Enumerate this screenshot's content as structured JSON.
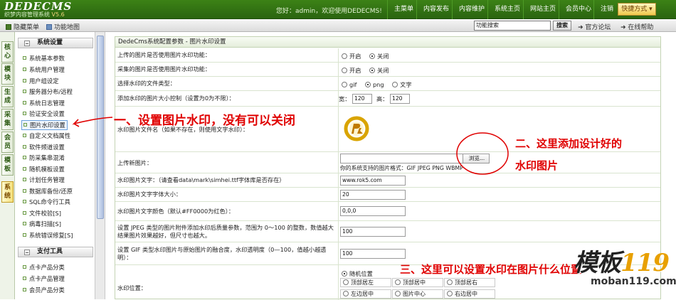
{
  "header": {
    "logo": "DEDECMS",
    "logo_sub": "织梦内容管理系统",
    "version": "V5.6",
    "welcome": "您好：admin，欢迎使用DEDECMS!",
    "nav": [
      "主菜单",
      "内容发布",
      "内容维护",
      "系统主页",
      "网站主页",
      "会员中心",
      "注销"
    ],
    "quick": "快捷方式"
  },
  "toolbar": {
    "hide_menu": "隐藏菜单",
    "func_map": "功能地图",
    "search_value": "功能搜索",
    "search_btn": "搜索",
    "forum": "官方论坛",
    "help": "在线帮助"
  },
  "vtabs": [
    "核心",
    "模块",
    "生成",
    "采集",
    "会员",
    "模板",
    "系统"
  ],
  "sidebar": {
    "section1": "系统设置",
    "items1": [
      "系统基本参数",
      "系统用户管理",
      "用户组设定",
      "服务器分布/远程",
      "系统日志管理",
      "验证安全设置",
      "图片水印设置",
      "自定义文档属性",
      "软件频道设置",
      "防采集串混淆",
      "随机模板设置",
      "计划任务管理",
      "数据库备份/还原",
      "SQL命令行工具",
      "文件校验[S]",
      "病毒扫描[S]",
      "系统错误修复[S]"
    ],
    "section2": "支付工具",
    "items2": [
      "点卡产品分类",
      "点卡产品管理",
      "会员产品分类"
    ]
  },
  "main": {
    "title": "DedeCms系统配置参数 - 图片水印设置",
    "rows": {
      "upload_wm_label": "上传的图片是否使用图片水印功能：",
      "collect_wm_label": "采集的图片是否使用图片水印功能：",
      "filetype_label": "选择水印的文件类型：",
      "size_label": "添加水印的图片大小控制（设置为0为不限）：",
      "width_label": "宽：",
      "width_value": "120",
      "height_label": "高：",
      "height_value": "120",
      "wmfile_label": "水印图片文件名（如果不存在，则使用文字水印）：",
      "upload_label": "上传新图片：",
      "browse_btn": "浏览...",
      "formats_note": "你的系统支持的图片格式：GIF JPEG PNG WBMP",
      "wmtext_label": "水印图片文字：（请查看data\\mark\\simhei.ttf字体库是否存在）",
      "wmtext_value": "www.rok5.com",
      "fontsize_label": "水印图片文字字体大小：",
      "fontsize_value": "20",
      "color_label": "水印图片文字颜色（默认#FF0000为红色）：",
      "color_value": "0,0,0",
      "jpeg_label": "设置 JPEG 类型的图片附件添加水印后质量参数，范围为 0～100 的整数，数值越大结果图片效果越好，但尺寸也越大。",
      "jpeg_value": "100",
      "gif_label": "设置 GIF 类型水印图片与原始图片的融合度，水印透明度（0—100，值越小越透明）：",
      "gif_value": "100",
      "position_label": "水印位置："
    },
    "on": "开启",
    "off": "关闭",
    "filetypes": [
      "gif",
      "png",
      "文字"
    ],
    "positions": [
      "随机位置",
      "顶部居左",
      "顶部居中",
      "顶部居右",
      "左边居中",
      "图片中心",
      "右边居中"
    ]
  },
  "annotations": {
    "a1": "一、设置图片水印，没有可以关闭",
    "a2_line1": "二、这里添加设计好的",
    "a2_line2": "水印图片",
    "a3": "三、这里可以设置水印在图片什么位置"
  },
  "watermark": {
    "brand": "模板",
    "num": "119",
    "url": "moban119.com"
  }
}
